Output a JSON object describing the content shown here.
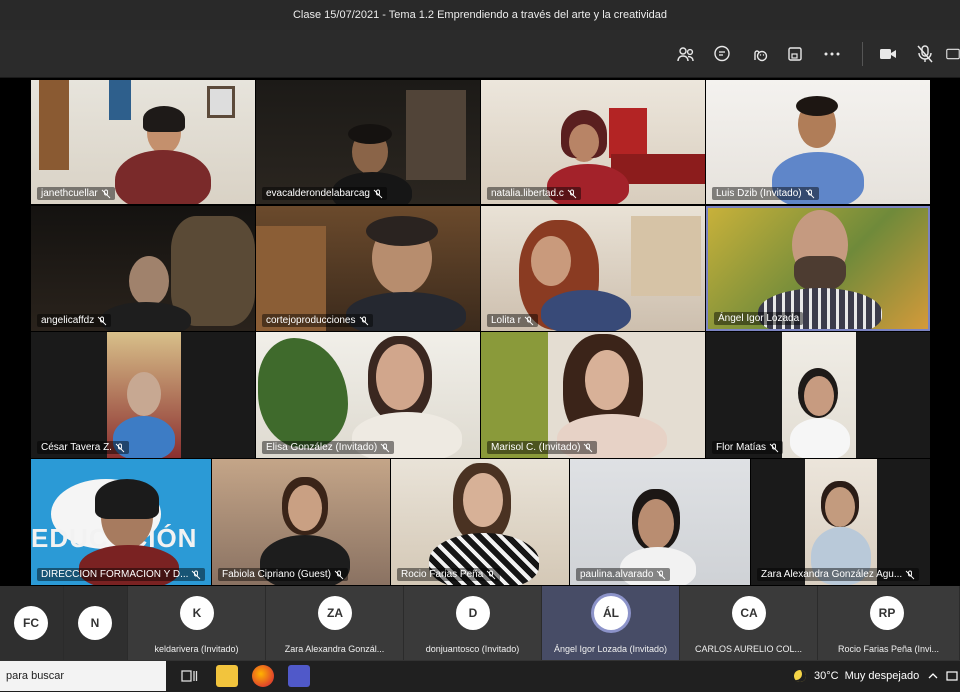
{
  "window": {
    "title": "Clase 15/07/2021 - Tema 1.2 Emprendiendo a través del arte y la creatividad"
  },
  "toolbar": {
    "icons": [
      "people-icon",
      "chat-icon",
      "reactions-icon",
      "share-tray-icon",
      "more-icon",
      "camera-icon",
      "mic-off-icon",
      "share-icon"
    ]
  },
  "tiles": [
    {
      "name": "janethcuellar"
    },
    {
      "name": "evacalderondelabarcag"
    },
    {
      "name": "natalia.libertad.c"
    },
    {
      "name": "Luis Dzib (Invitado)"
    },
    {
      "name": "angelicaffdz"
    },
    {
      "name": "cortejoproducciones"
    },
    {
      "name": "Lolita r"
    },
    {
      "name": "Ángel Igor Lozada"
    },
    {
      "name": "César Tavera Z."
    },
    {
      "name": "Elisa González (Invitado)"
    },
    {
      "name": "Marisol C. (Invitado)"
    },
    {
      "name": "Flor Matías"
    },
    {
      "name": "DIRECCION FORMACION Y D..."
    },
    {
      "name": "Fabiola Cipriano (Guest)"
    },
    {
      "name": "Rocio Farias Peña"
    },
    {
      "name": "paulina.alvarado"
    },
    {
      "name": "Zara Alexandra González Agu..."
    }
  ],
  "overflow_text": "EDUCACIÓN",
  "participants": [
    {
      "initials": "FC",
      "name": ""
    },
    {
      "initials": "N",
      "name": ""
    },
    {
      "initials": "K",
      "name": "keldarivera (Invitado)"
    },
    {
      "initials": "ZA",
      "name": "Zara Alexandra Gonzál..."
    },
    {
      "initials": "D",
      "name": "donjuantosco (Invitado)"
    },
    {
      "initials": "ÁL",
      "name": "Ángel Igor Lozada (Invitado)"
    },
    {
      "initials": "CA",
      "name": "CARLOS AURELIO COL..."
    },
    {
      "initials": "RP",
      "name": "Rocio Farias Peña (Invi..."
    }
  ],
  "taskbar": {
    "search_text": "para buscar",
    "temperature": "30°C",
    "weather": "Muy despejado"
  },
  "colors": {
    "toolbar_bg": "#2b2b2b",
    "strip_bg": "#2b2b2b",
    "active_card": "#474c66",
    "avatar_ring": "#8c93c9"
  }
}
